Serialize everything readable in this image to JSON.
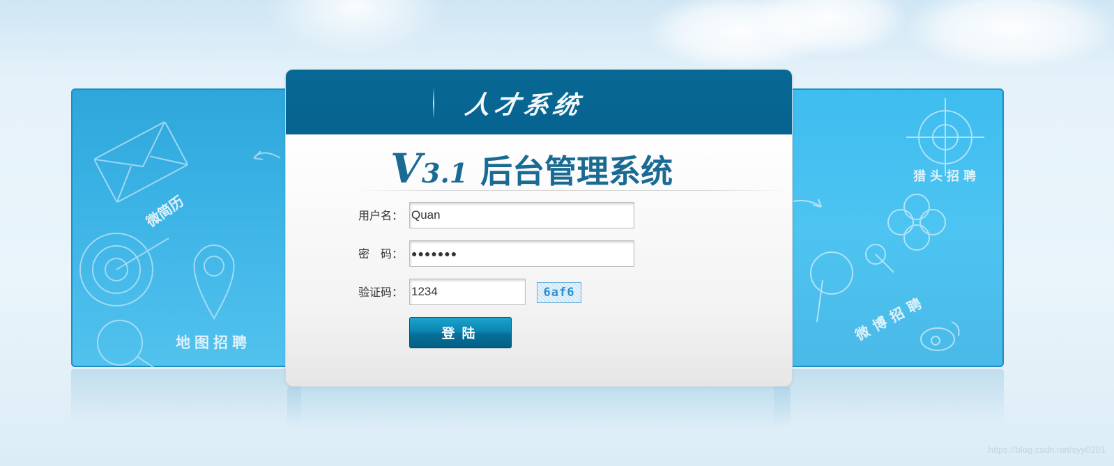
{
  "header": {
    "title": "人才系统"
  },
  "version_title": {
    "v": "V",
    "num": "3.1",
    "text": "后台管理系统"
  },
  "form": {
    "username_label": "用户名：",
    "username_value": "Quan",
    "password_label": "密　码：",
    "password_value": "●●●●●●●",
    "captcha_label": "验证码：",
    "captcha_value": "1234",
    "captcha_image_text": "6af6",
    "login_label": "登陆"
  },
  "left_panel": {
    "labels": [
      "微简历",
      "地图招聘"
    ]
  },
  "right_panel": {
    "labels": [
      "猎头招聘",
      "微博招聘"
    ]
  },
  "watermark": "https://blog.csdn.net/syy0201",
  "colors": {
    "header": "#076390",
    "accent": "#1a6a94",
    "panel": "#3db4e6",
    "button": "#0b86b2"
  }
}
